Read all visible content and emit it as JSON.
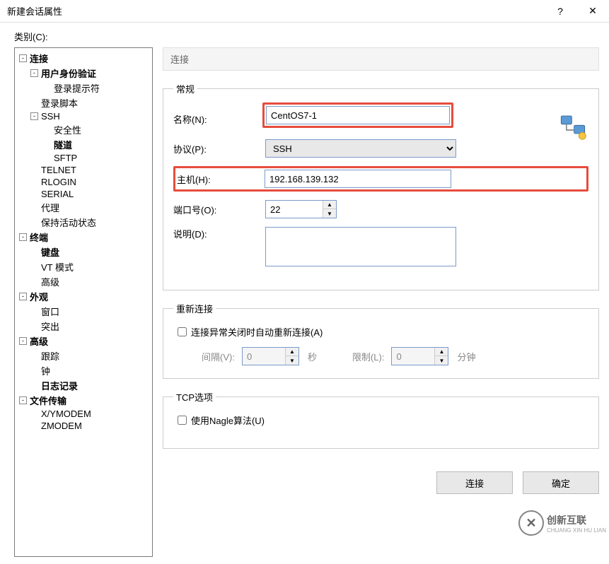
{
  "window": {
    "title": "新建会话属性"
  },
  "categoryLabel": "类别(C):",
  "tree": {
    "connection": "连接",
    "userAuth": "用户身份验证",
    "loginPrompt": "登录提示符",
    "loginScript": "登录脚本",
    "ssh": "SSH",
    "security": "安全性",
    "tunnel": "隧道",
    "sftp": "SFTP",
    "telnet": "TELNET",
    "rlogin": "RLOGIN",
    "serial": "SERIAL",
    "proxy": "代理",
    "keepAlive": "保持活动状态",
    "terminal": "终端",
    "keyboard": "键盘",
    "vtMode": "VT 模式",
    "advanced": "高级",
    "appearance": "外观",
    "windowItem": "窗口",
    "highlight": "突出",
    "advanced2": "高级",
    "trace": "跟踪",
    "bell": "钟",
    "logging": "日志记录",
    "fileTransfer": "文件传输",
    "xymodem": "X/YMODEM",
    "zmodem": "ZMODEM"
  },
  "rhs": {
    "sectionHeader": "连接",
    "general": {
      "legend": "常规",
      "nameLabel": "名称(N):",
      "nameValue": "CentOS7-1",
      "protocolLabel": "协议(P):",
      "protocolValue": "SSH",
      "hostLabel": "主机(H):",
      "hostValue": "192.168.139.132",
      "portLabel": "端口号(O):",
      "portValue": "22",
      "descLabel": "说明(D):",
      "descValue": ""
    },
    "reconnect": {
      "legend": "重新连接",
      "chkLabel": "连接异常关闭时自动重新连接(A)",
      "intervalLabel": "间隔(V):",
      "intervalValue": "0",
      "unitSec": "秒",
      "limitLabel": "限制(L):",
      "limitValue": "0",
      "unitMin": "分钟"
    },
    "tcp": {
      "legend": "TCP选项",
      "nagleLabel": "使用Nagle算法(U)"
    }
  },
  "buttons": {
    "connect": "连接",
    "ok": "确定"
  },
  "watermark": {
    "main": "创新互联",
    "sub": "CHUANG XIN HU LIAN"
  }
}
